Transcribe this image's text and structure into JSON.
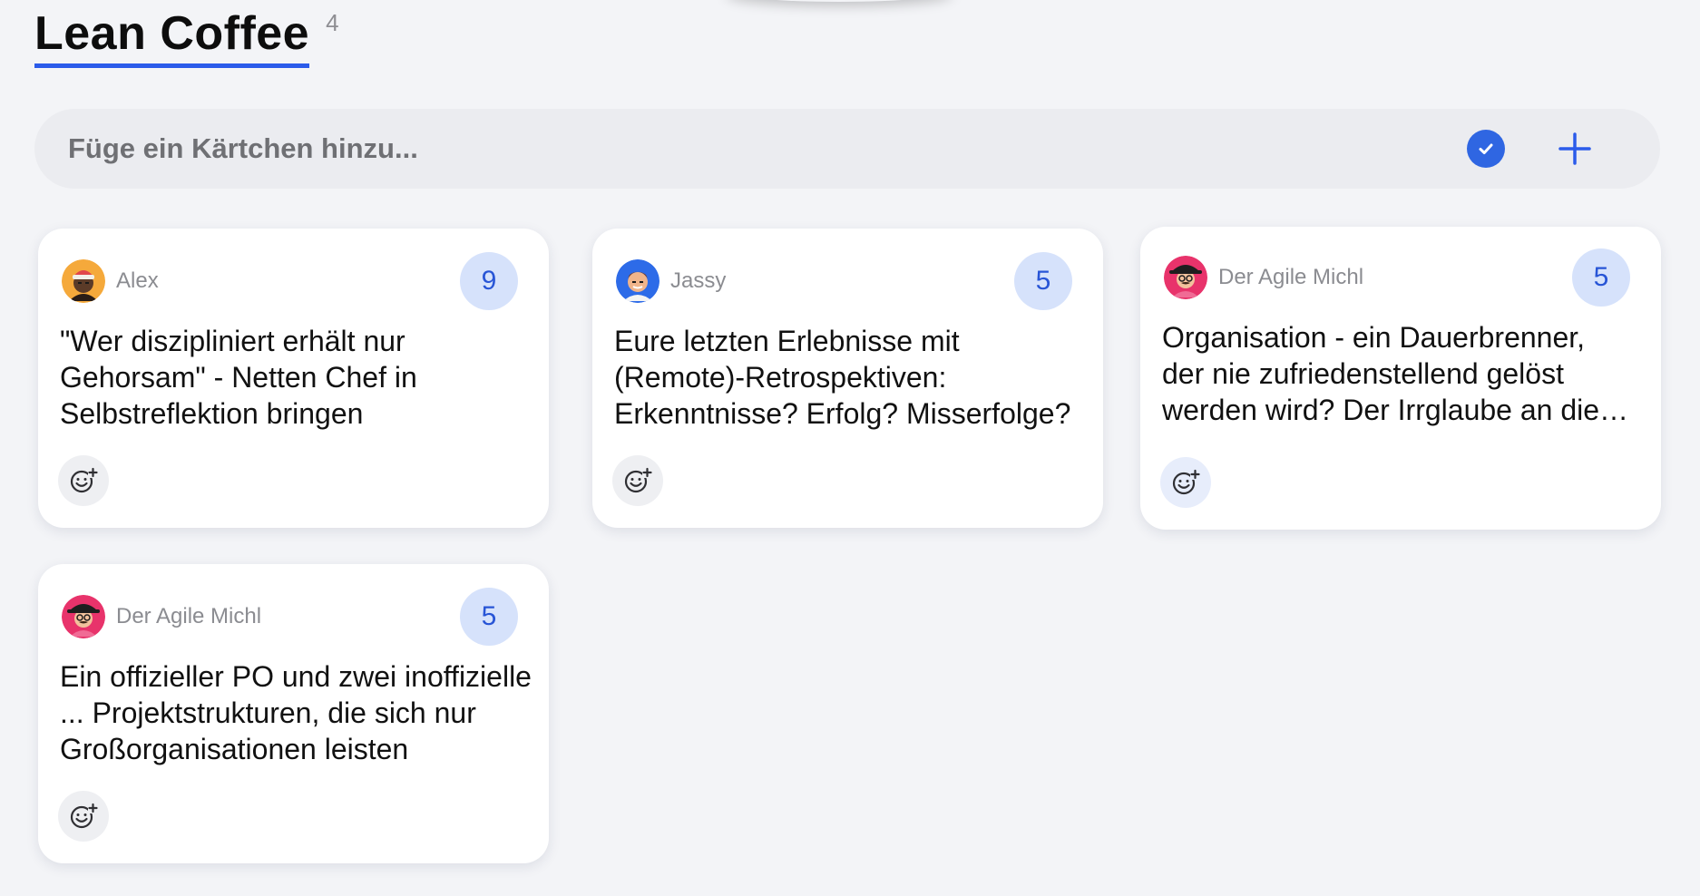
{
  "board": {
    "title": "Lean Coffee",
    "count": "4"
  },
  "add_card": {
    "placeholder": "Füge ein Kärtchen hinzu..."
  },
  "icons": {
    "confirm": "check-circle-icon",
    "add": "plus-icon",
    "reaction": "add-emoji-icon"
  },
  "colors": {
    "accent": "#2b5bea",
    "vote_badge_bg": "#d6e2fb",
    "vote_badge_text": "#2855d6"
  },
  "cards": [
    {
      "author": "Alex",
      "votes": "9",
      "text": "\"Wer diszipliniert erhält nur Gehorsam\" - Netten Chef in Selbstreflektion bringen"
    },
    {
      "author": "Jassy",
      "votes": "5",
      "text": "Eure letzten Erlebnisse mit (Remote)-Retrospektiven: Erkenntnisse? Erfolg? Misserfolge?"
    },
    {
      "author": "Der Agile Michl",
      "votes": "5",
      "text": "Organisation - ein Dauerbrenner, der nie zufriedenstellend gelöst werden wird? Der Irrglaube an die perfekte Struktur"
    },
    {
      "author": "Der Agile Michl",
      "votes": "5",
      "text": "Ein offizieller PO und zwei inoffizielle ... Projektstrukturen, die sich nur Großorganisationen leisten"
    }
  ]
}
